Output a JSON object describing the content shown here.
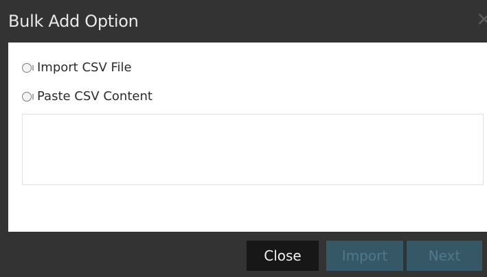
{
  "dialog": {
    "title": "Bulk Add Option",
    "close_glyph": "✕"
  },
  "options": [
    {
      "label": "Import CSV File",
      "selected": false
    },
    {
      "label": "Paste CSV Content",
      "selected": false
    }
  ],
  "csv_input": {
    "value": ""
  },
  "footer": {
    "close_label": "Close",
    "import_label": "Import",
    "next_label": "Next",
    "import_enabled": false,
    "next_enabled": false
  },
  "colors": {
    "chrome": "#333333",
    "primary_disabled": "#365866",
    "close_button": "#171717"
  }
}
